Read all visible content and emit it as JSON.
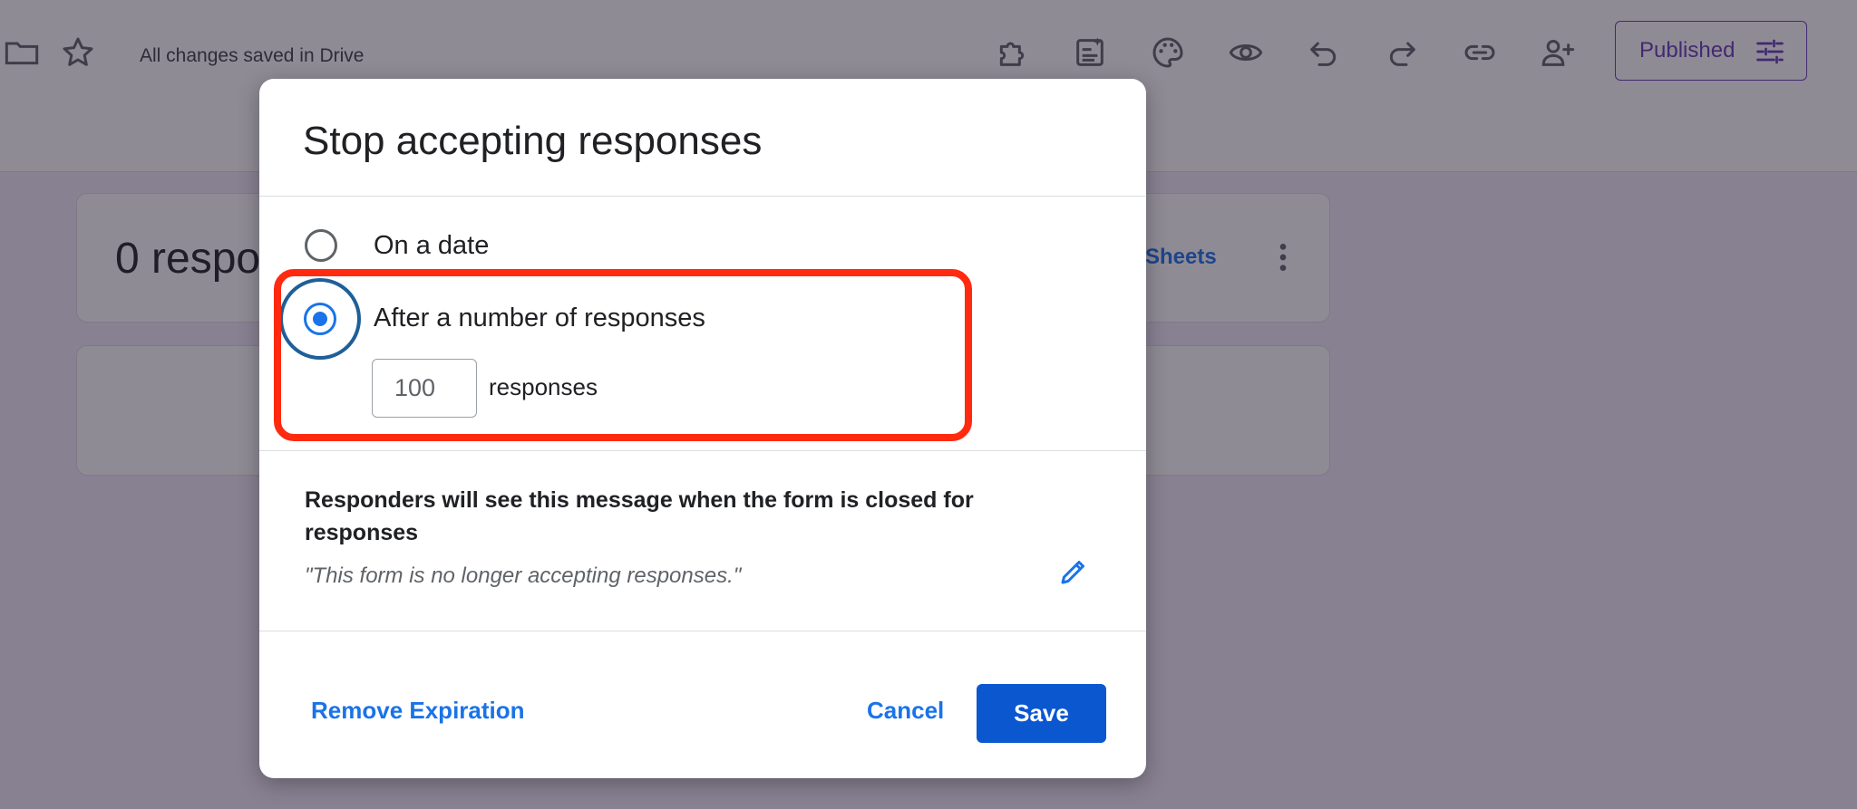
{
  "header": {
    "saved_status": "All changes saved in Drive",
    "published_label": "Published",
    "icons": [
      "folder-icon",
      "star-icon",
      "addon-icon",
      "customize-theme-icon",
      "palette-icon",
      "preview-icon",
      "undo-icon",
      "redo-icon",
      "link-icon",
      "add-collaborator-icon",
      "tune-icon"
    ]
  },
  "background": {
    "responses_title": "0 respo",
    "sheets_link": "Sheets"
  },
  "dialog": {
    "title": "Stop accepting responses",
    "options": [
      {
        "label": "On a date",
        "selected": false
      },
      {
        "label": "After a number of responses",
        "selected": true
      }
    ],
    "response_count": "100",
    "response_suffix": "responses",
    "message_heading": "Responders will see this message when the form is closed for responses",
    "message_text": "\"This form is no longer accepting responses.\"",
    "remove_label": "Remove Expiration",
    "cancel_label": "Cancel",
    "save_label": "Save"
  },
  "colors": {
    "accent": "#1a73e8",
    "primary_button": "#0b57d0",
    "highlight": "#ff2a10",
    "forms_purple": "#673ab7"
  }
}
